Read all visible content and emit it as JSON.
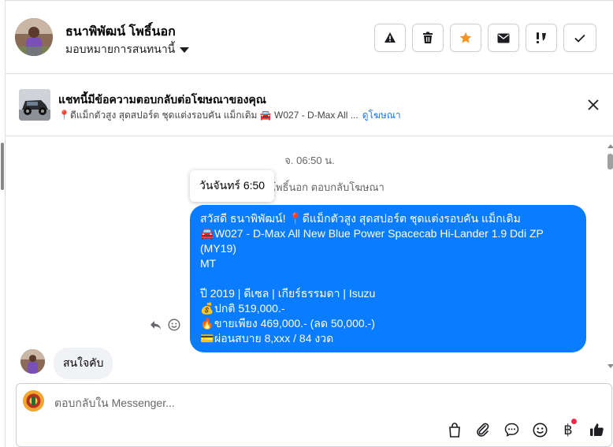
{
  "header": {
    "name": "ธนาพิพัฒน์ โพธิ์นอก",
    "assign_label": "มอบหมายการสนทนานี้",
    "actions": [
      {
        "icon": "warning-icon"
      },
      {
        "icon": "trash-icon"
      },
      {
        "icon": "star-icon",
        "color": "#f7931e"
      },
      {
        "icon": "envelope-icon"
      },
      {
        "icon": "follow-up-icon"
      },
      {
        "icon": "checkmark-icon"
      }
    ]
  },
  "ad": {
    "title": "แชทนี้มีข้อความตอบกลับต่อโฆษณาของคุณ",
    "subtitle": "📍ดีแม็กตัวสูง สุดสปอร์ต ชุดแต่งรอบคัน แม็กเดิม 🚘 W027 - D-Max All ...",
    "link": "ดูโฆษณา"
  },
  "conversation": {
    "timestamp": "จ. 06:50 น.",
    "tooltip": "วันจันทร์ 6:50",
    "replied_note": "โพธิ์นอก ตอบกลับโฆษณา",
    "outgoing_lines": [
      {
        "emoji": "",
        "text": "สวัสดี ธนาพิพัฒน์! 📍ดีแม็กตัวสูง สุดสปอร์ต ชุดแต่งรอบคัน แม็กเดิม"
      },
      {
        "emoji": "🚘",
        "text": "W027 - D-Max All New Blue Power Spacecab Hi-Lander 1.9 Ddi ZP (MY19)"
      },
      {
        "emoji": "",
        "text": "MT"
      },
      {
        "emoji": "",
        "text": ""
      },
      {
        "emoji": "",
        "text": "ปี 2019 | ดีเซล | เกียร์ธรรมดา | Isuzu"
      },
      {
        "emoji": "💰",
        "text": "ปกติ 519,000.-"
      },
      {
        "emoji": "🔥",
        "text": "ขายเพียง 469,000.- (ลด 50,000.-)"
      },
      {
        "emoji": "💳",
        "text": "ผ่อนสบาย 8,xxx / 84 งวด"
      }
    ],
    "incoming_text": "สนใจคับ"
  },
  "composer": {
    "placeholder": "ตอบกลับใน Messenger...",
    "baht_symbol": "฿"
  },
  "colors": {
    "accent": "#0a7cff",
    "star": "#f7931e",
    "notification_dot": "#f02849"
  }
}
